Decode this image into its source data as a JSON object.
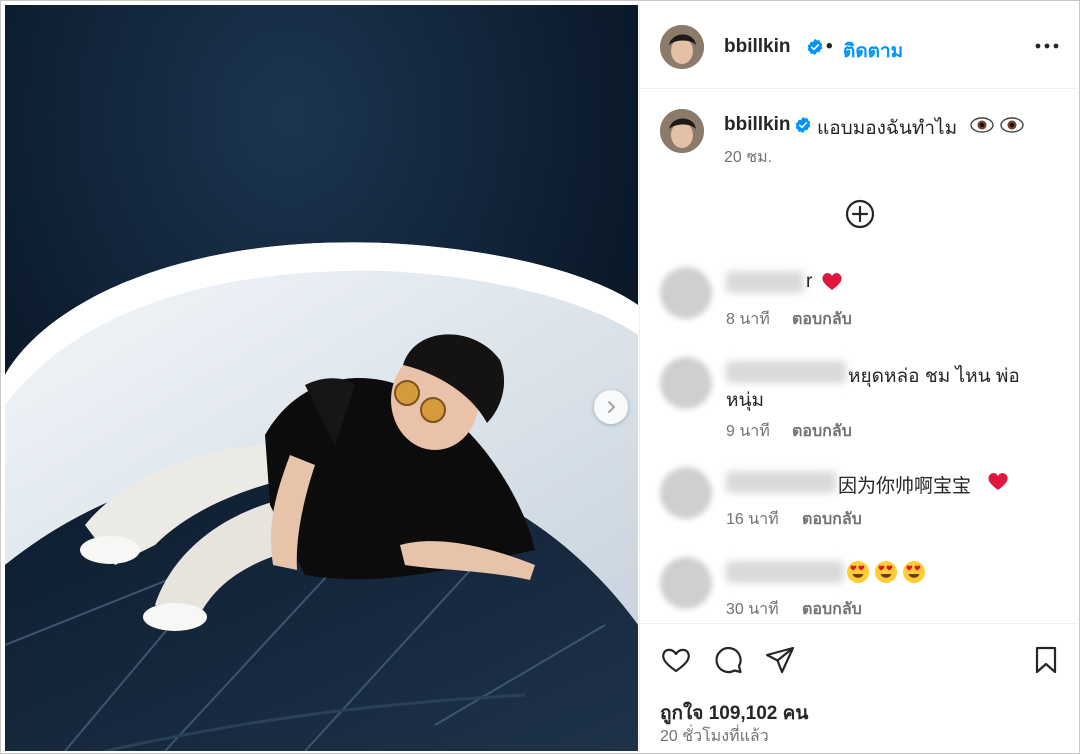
{
  "post": {
    "username": "bbillkin",
    "follow_label": "ติดตาม",
    "dot": "•",
    "caption": "แอบมองฉันทำไม",
    "caption_time": "20 ชม.",
    "likes": "ถูกใจ 109,102 คน",
    "posted": "20 ชั่วโมงที่แล้ว"
  },
  "comments": [
    {
      "text_tail": "r",
      "emoji": [
        "red-heart"
      ],
      "time": "8 นาที",
      "reply": "ตอบกลับ"
    },
    {
      "text_tail": "หยุดหล่อ ชม ไหน พ่อ",
      "text_line2": "หนุ่ม",
      "time": "9 นาที",
      "reply": "ตอบกลับ"
    },
    {
      "text_tail": "因为你帅啊宝宝",
      "emoji": [
        "red-heart"
      ],
      "time": "16 นาที",
      "reply": "ตอบกลับ"
    },
    {
      "text_tail": "",
      "emoji": [
        "heart-eyes",
        "heart-eyes",
        "heart-eyes"
      ],
      "time": "30 นาที",
      "reply": "ตอบกลับ"
    }
  ],
  "colors": {
    "accent": "#0095f6",
    "verified": "#0095f6",
    "heart": "#e0163d",
    "text": "#262626",
    "muted": "#737373"
  },
  "icons": [
    "verified-badge-icon",
    "more-options-icon",
    "add-circle-icon",
    "heart-icon",
    "comment-icon",
    "share-icon",
    "bookmark-icon",
    "chevron-right-icon",
    "eye-emoji-icon"
  ]
}
